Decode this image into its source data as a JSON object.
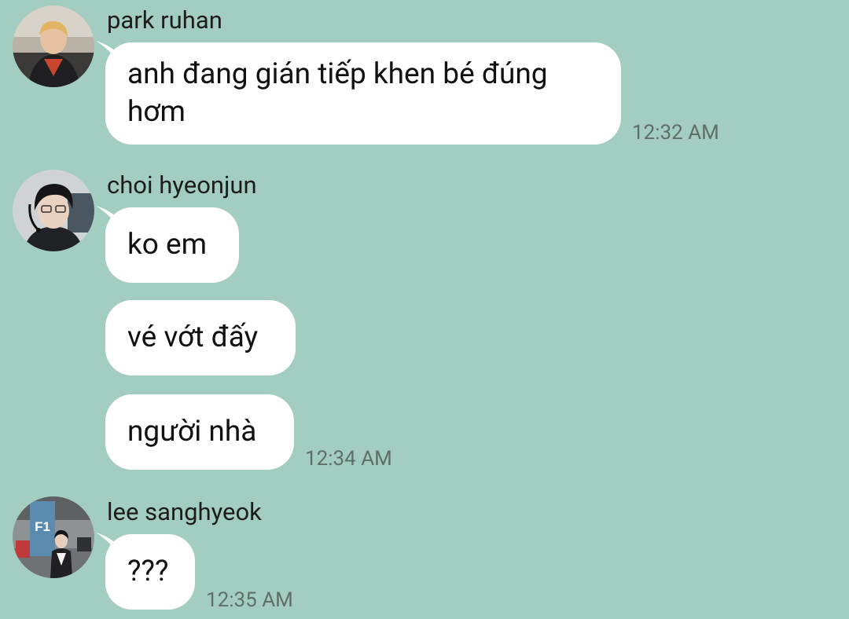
{
  "messages": [
    {
      "sender": "park ruhan",
      "bubbles": [
        {
          "text": "anh đang gián tiếp khen bé đúng hơm"
        }
      ],
      "time": "12:32 AM"
    },
    {
      "sender": "choi hyeonjun",
      "bubbles": [
        {
          "text": "ko em"
        },
        {
          "text": "vé vớt đấy"
        },
        {
          "text": "người nhà"
        }
      ],
      "time": "12:34 AM"
    },
    {
      "sender": "lee sanghyeok",
      "avatar_sign": "F1",
      "bubbles": [
        {
          "text": "???"
        }
      ],
      "time": "12:35 AM"
    }
  ],
  "colors": {
    "background": "#a4cdc1",
    "bubble": "#ffffff",
    "timestamp": "#5e6f69"
  }
}
